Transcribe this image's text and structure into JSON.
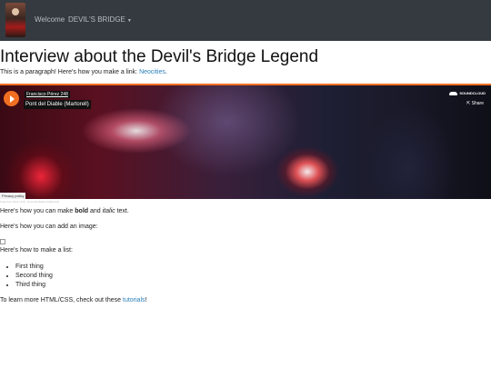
{
  "nav": {
    "welcome": "Welcome",
    "dropdown": "DEVIL'S BRIDGE"
  },
  "page": {
    "title": "Interview about the Devil's Bridge Legend",
    "intro_text": "This is a paragraph! Here's how you make a link: ",
    "intro_link": "Neocities",
    "intro_end": ".",
    "bold_prefix": "Here's how you can make ",
    "bold_word": "bold",
    "bold_mid": " and ",
    "italic_word": "italic",
    "bold_end": " text.",
    "image_text": "Here's how you can add an image:",
    "list_text": "Here's how to make a list:",
    "list_items": [
      "First thing",
      "Second thing",
      "Third thing"
    ],
    "learn_prefix": "To learn more HTML/CSS, check out these ",
    "learn_link": "tutorials",
    "learn_end": "!"
  },
  "player": {
    "artist": "Francisco Pérez 248",
    "track": "Pont del Diable (Martorell)",
    "brand": "SOUNDCLOUD",
    "share": "Share",
    "privacy": "Privacy policy",
    "below_text": "Francisco Pérez 248 · Pont del Diable (Martorell)",
    "accent": "#f26f21"
  },
  "colors": {
    "navbar": "#343a40",
    "link": "#2a7fb8"
  }
}
